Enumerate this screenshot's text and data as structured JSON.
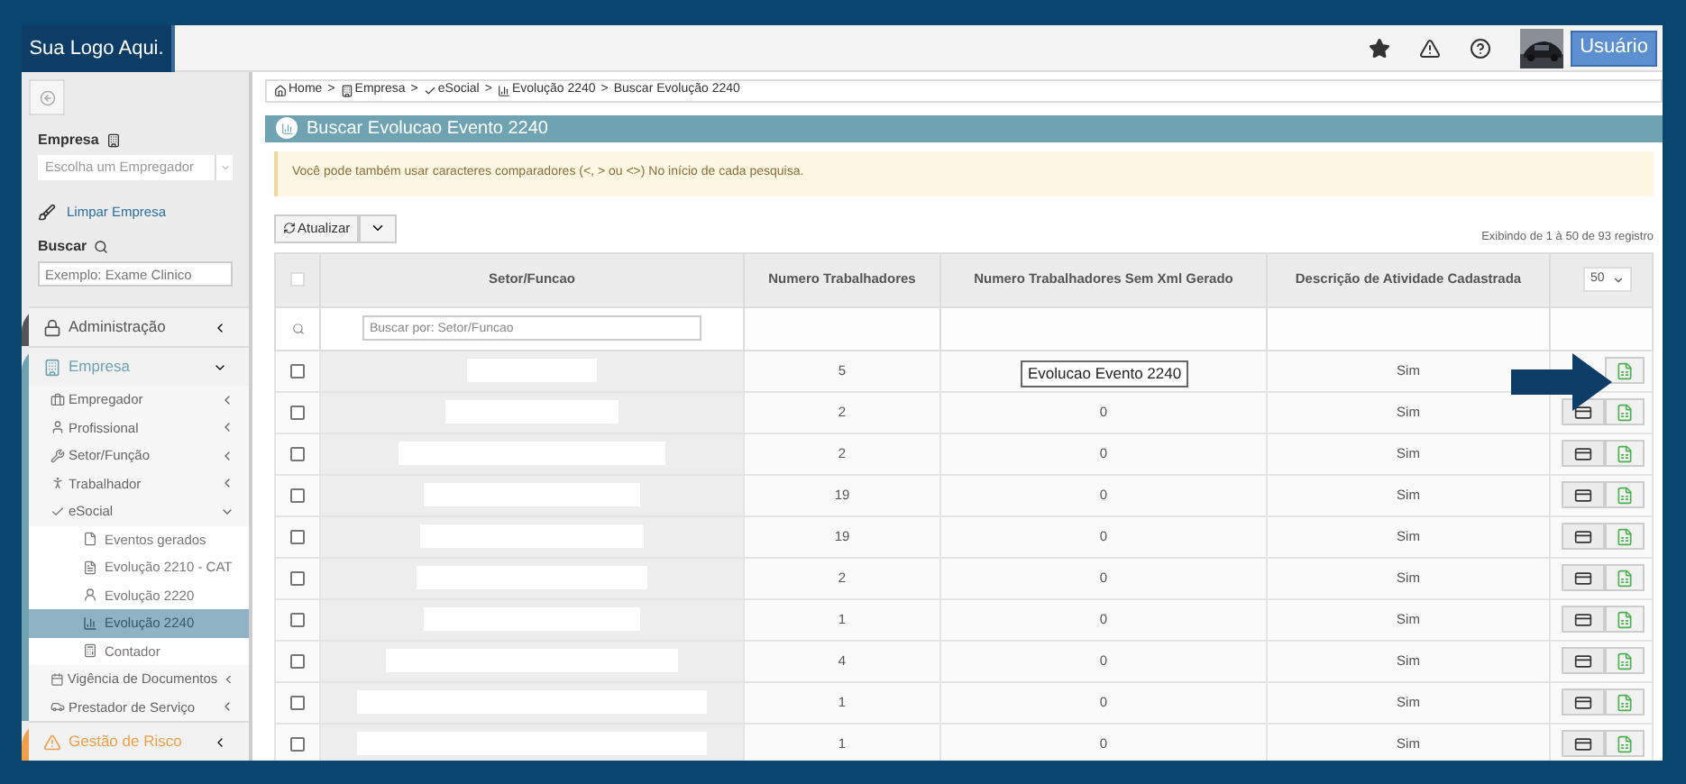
{
  "header": {
    "logo": "Sua Logo Aqui.",
    "user": "Usuário"
  },
  "sidebar": {
    "company_label": "Empresa",
    "company_select": {
      "placeholder": "Escolha um Empregador"
    },
    "clear_link": "Limpar Empresa",
    "search_label": "Buscar",
    "search": {
      "placeholder": "Exemplo: Exame Clinico"
    },
    "menu": [
      {
        "label": "Administração",
        "color": "#555555",
        "expanded": false
      },
      {
        "label": "Empresa",
        "color": "#6fa3b1",
        "expanded": true,
        "children": [
          {
            "label": "Empregador",
            "expanded": false
          },
          {
            "label": "Profissional",
            "expanded": false
          },
          {
            "label": "Setor/Função",
            "expanded": false
          },
          {
            "label": "Trabalhador",
            "expanded": false
          },
          {
            "label": "eSocial",
            "expanded": true,
            "children": [
              {
                "label": "Eventos gerados",
                "selected": false
              },
              {
                "label": "Evolução 2210 - CAT",
                "selected": false
              },
              {
                "label": "Evolução 2220",
                "selected": false
              },
              {
                "label": "Evolução 2240",
                "selected": true
              },
              {
                "label": "Contador",
                "selected": false
              }
            ]
          },
          {
            "label": "Vigência de Documentos",
            "expanded": false
          },
          {
            "label": "Prestador de Serviço",
            "expanded": false
          }
        ]
      },
      {
        "label": "Gestão de Risco",
        "color": "#f0a04b",
        "expanded": false
      }
    ]
  },
  "breadcrumb": [
    {
      "label": "Home",
      "separator": ">"
    },
    {
      "label": "Empresa",
      "separator": ">"
    },
    {
      "label": "eSocial",
      "separator": ">"
    },
    {
      "label": "Evolução 2240",
      "separator": ">"
    },
    {
      "label": "Buscar Evolução 2240"
    }
  ],
  "panel": {
    "title": "Buscar Evolucao Evento 2240",
    "alert": "Você pode também usar caracteres comparadores (<, > ou <>) No início de cada pesquisa.",
    "refresh": "Atualizar",
    "count": "Exibindo de 1 à 50 de 93 registro",
    "page_size": "50"
  },
  "table": {
    "select_all": {
      "checked": false
    },
    "columns": [
      "Setor/Funcao",
      "Numero Trabalhadores",
      "Numero Trabalhadores Sem Xml Gerado",
      "Descrição de Atividade Cadastrada"
    ],
    "filter": {
      "placeholder": "Buscar por: Setor/Funcao"
    },
    "rows": [
      {
        "checked": false,
        "workers": "5",
        "description": "Sim"
      },
      {
        "checked": false,
        "workers": "2",
        "without_xml": "0",
        "description": "Sim"
      },
      {
        "checked": false,
        "workers": "2",
        "without_xml": "0",
        "description": "Sim"
      },
      {
        "checked": false,
        "workers": "19",
        "without_xml": "0",
        "description": "Sim"
      },
      {
        "checked": false,
        "workers": "19",
        "without_xml": "0",
        "description": "Sim"
      },
      {
        "checked": false,
        "workers": "2",
        "without_xml": "0",
        "description": "Sim"
      },
      {
        "checked": false,
        "workers": "1",
        "without_xml": "0",
        "description": "Sim"
      },
      {
        "checked": false,
        "workers": "4",
        "without_xml": "0",
        "description": "Sim"
      },
      {
        "checked": false,
        "workers": "1",
        "without_xml": "0",
        "description": "Sim"
      },
      {
        "checked": false,
        "workers": "1",
        "without_xml": "0",
        "description": "Sim"
      }
    ]
  },
  "tooltip": "Evolucao Evento 2240"
}
